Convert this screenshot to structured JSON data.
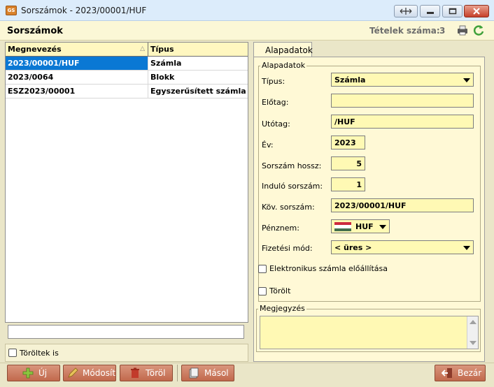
{
  "window": {
    "title": "Sorszámok - 2023/00001/HUF",
    "app_badge": "GS"
  },
  "header": {
    "title": "Sorszámok",
    "count_label": "Tételek száma:",
    "count_value": "3"
  },
  "grid": {
    "columns": [
      "Megnevezés",
      "Típus"
    ],
    "rows": [
      {
        "name": "2023/00001/HUF",
        "type": "Számla",
        "selected": true
      },
      {
        "name": "2023/0064",
        "type": "Blokk",
        "selected": false
      },
      {
        "name": "ESZ2023/00001",
        "type": "Egyszerűsített számla",
        "selected": false
      }
    ]
  },
  "filter": {
    "value": "",
    "deleted_label": "Töröltek is"
  },
  "tab": {
    "label": "Alapadatok"
  },
  "form": {
    "group_label": "Alapadatok",
    "type_label": "Típus:",
    "type_value": "Számla",
    "prefix_label": "Előtag:",
    "prefix_value": "",
    "suffix_label": "Utótag:",
    "suffix_value": "/HUF",
    "year_label": "Év:",
    "year_value": "2023",
    "length_label": "Sorszám hossz:",
    "length_value": "5",
    "start_label": "Induló sorszám:",
    "start_value": "1",
    "next_label": "Köv. sorszám:",
    "next_value": "2023/00001/HUF",
    "currency_label": "Pénznem:",
    "currency_value": "HUF",
    "payment_label": "Fizetési mód:",
    "payment_value": "< üres >",
    "einvoice_label": "Elektronikus számla előállítása",
    "deleted_label": "Törölt",
    "notes_label": "Megjegyzés"
  },
  "toolbar": {
    "new": "Új",
    "edit": "Módosít",
    "delete": "Töröl",
    "copy": "Másol",
    "close": "Bezár"
  },
  "colors": {
    "selection": "#0a78d4",
    "field_bg": "#fff9b4",
    "panel_bg": "#fff9d6",
    "button": "#c97a5e"
  },
  "icons": [
    "app-icon",
    "print-icon",
    "refresh-icon",
    "plus-icon",
    "pencil-icon",
    "trash-icon",
    "copy-icon",
    "exit-icon",
    "hungary-flag-icon"
  ]
}
